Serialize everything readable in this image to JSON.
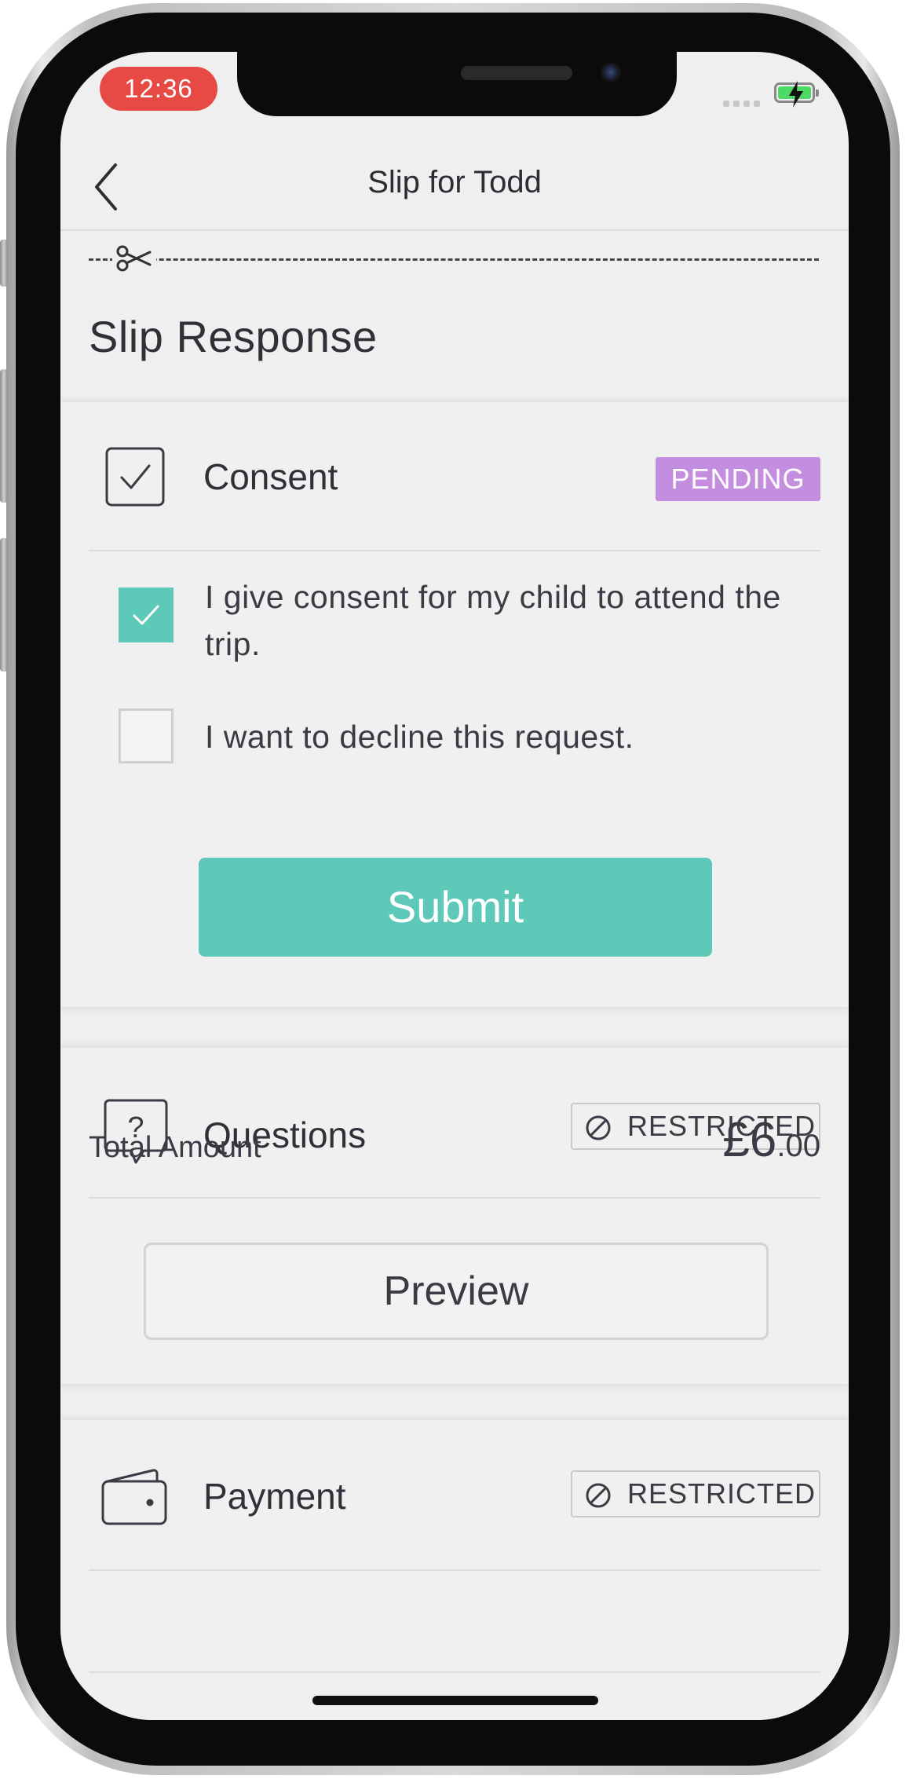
{
  "status_bar": {
    "time": "12:36",
    "battery_color": "#4cd964"
  },
  "nav": {
    "back_icon": "chevron-left-icon",
    "title": "Slip for Todd"
  },
  "page": {
    "title": "Slip Response"
  },
  "consent": {
    "icon": "checkbox-icon",
    "title": "Consent",
    "status": "PENDING",
    "status_color": "#c48ee0",
    "options": [
      {
        "text": "I give consent for my child to attend the trip.",
        "checked": true
      },
      {
        "text": "I want to decline this request.",
        "checked": false
      }
    ],
    "submit_label": "Submit",
    "accent_color": "#5fc9b9"
  },
  "questions": {
    "icon": "question-bubble-icon",
    "title": "Questions",
    "status": "RESTRICTED",
    "preview_label": "Preview"
  },
  "payment": {
    "icon": "wallet-icon",
    "title": "Payment",
    "status": "RESTRICTED",
    "total_label": "Total Amount",
    "total_major": "£6",
    "total_minor": ".00"
  }
}
